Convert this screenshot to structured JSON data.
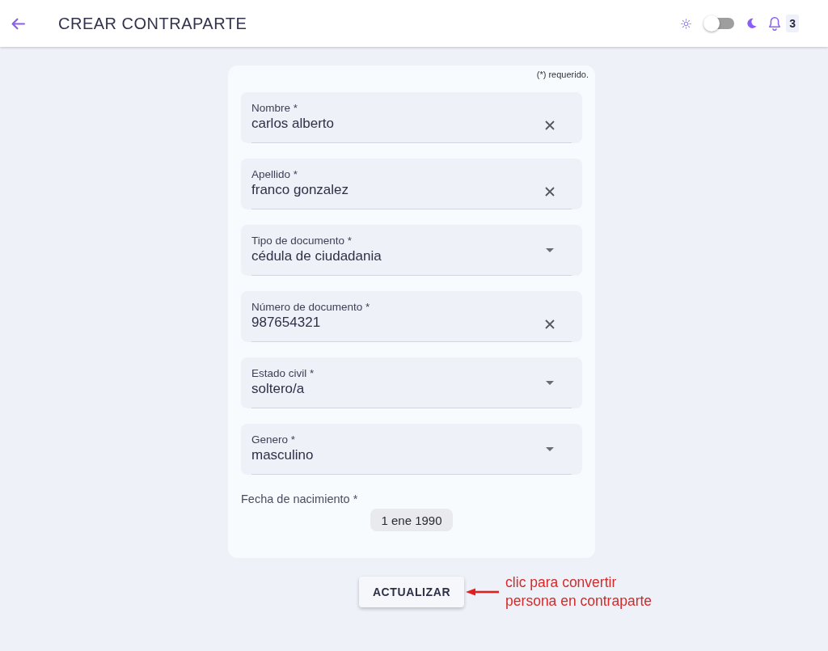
{
  "header": {
    "title": "CREAR CONTRAPARTE",
    "theme_toggle": {
      "on": false
    },
    "notifications": {
      "count": "3"
    }
  },
  "form": {
    "required_note": "(*) requerido.",
    "fields": [
      {
        "kind": "text",
        "label": "Nombre *",
        "value": "carlos alberto"
      },
      {
        "kind": "text",
        "label": "Apellido *",
        "value": "franco gonzalez"
      },
      {
        "kind": "select",
        "label": "Tipo de documento *",
        "value": "cédula de ciudadania"
      },
      {
        "kind": "text",
        "label": "Número de documento *",
        "value": "987654321"
      },
      {
        "kind": "select",
        "label": "Estado civil *",
        "value": "soltero/a"
      },
      {
        "kind": "select",
        "label": "Genero *",
        "value": "masculino"
      }
    ],
    "birth_date": {
      "label": "Fecha de nacimiento *",
      "value": "1 ene 1990"
    }
  },
  "actions": {
    "submit_label": "ACTUALIZAR"
  },
  "annotation": {
    "text": "clic para convertir persona en contraparte"
  }
}
